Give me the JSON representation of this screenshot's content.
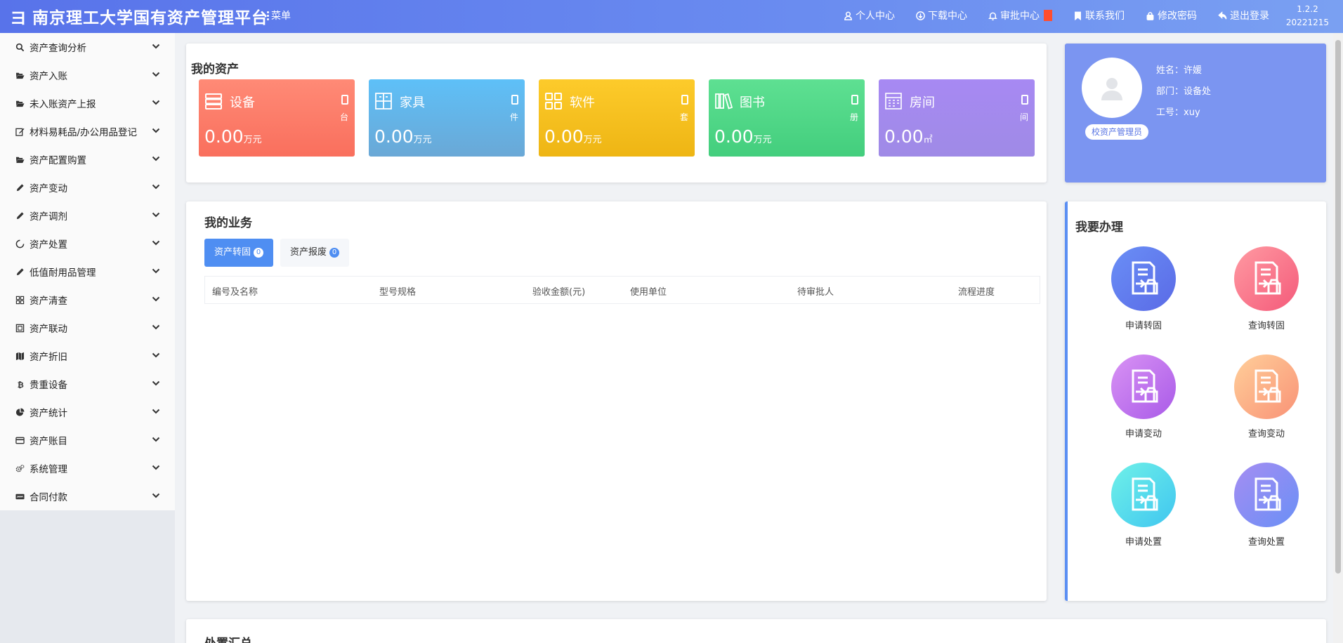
{
  "header": {
    "logo_glyph": "ヨ",
    "title": "南京理工大学国有资产管理平台",
    "menu_label": "菜单",
    "links": [
      {
        "label": "个人中心",
        "icon": "user-icon"
      },
      {
        "label": "下载中心",
        "icon": "download-icon"
      },
      {
        "label": "审批中心",
        "icon": "bell-icon"
      },
      {
        "label": "联系我们",
        "icon": "bookmark-icon"
      },
      {
        "label": "修改密码",
        "icon": "lock-icon"
      },
      {
        "label": "退出登录",
        "icon": "logout-icon"
      }
    ],
    "version": "1.2.2",
    "build": "20221215"
  },
  "sidebar": {
    "items": [
      {
        "label": "资产查询分析",
        "icon": "search-icon"
      },
      {
        "label": "资产入账",
        "icon": "folder-open-icon"
      },
      {
        "label": "未入账资产上报",
        "icon": "folder-open-icon"
      },
      {
        "label": "材料易耗品/办公用品登记",
        "icon": "edit-icon"
      },
      {
        "label": "资产配置购置",
        "icon": "folder-open-icon"
      },
      {
        "label": "资产变动",
        "icon": "pencil-icon"
      },
      {
        "label": "资产调剂",
        "icon": "pencil-icon"
      },
      {
        "label": "资产处置",
        "icon": "circle-notch-icon"
      },
      {
        "label": "低值耐用品管理",
        "icon": "pencil-icon"
      },
      {
        "label": "资产清查",
        "icon": "grid-icon"
      },
      {
        "label": "资产联动",
        "icon": "frame-icon"
      },
      {
        "label": "资产折旧",
        "icon": "map-icon"
      },
      {
        "label": "贵重设备",
        "icon": "bitcoin-icon"
      },
      {
        "label": "资产统计",
        "icon": "pie-chart-icon"
      },
      {
        "label": "资产账目",
        "icon": "credit-card-icon"
      },
      {
        "label": "系统管理",
        "icon": "gears-icon"
      },
      {
        "label": "合同付款",
        "icon": "paypal-icon"
      }
    ]
  },
  "my_assets": {
    "title": "我的资产",
    "cards": [
      {
        "name": "设备",
        "unit": "台",
        "value": "0.00",
        "value_unit": "万元",
        "color_from": "#ff8a76",
        "color_to": "#f96f5d",
        "icon": "server-icon"
      },
      {
        "name": "家具",
        "unit": "件",
        "value": "0.00",
        "value_unit": "万元",
        "color_from": "#5ec0f8",
        "color_to": "#6aa8d6",
        "icon": "furniture-icon"
      },
      {
        "name": "软件",
        "unit": "套",
        "value": "0.00",
        "value_unit": "万元",
        "color_from": "#fdcb2b",
        "color_to": "#eeb514",
        "icon": "apps-icon"
      },
      {
        "name": "图书",
        "unit": "册",
        "value": "0.00",
        "value_unit": "万元",
        "color_from": "#5ee092",
        "color_to": "#43ce7d",
        "icon": "books-icon"
      },
      {
        "name": "房间",
        "unit": "间",
        "value": "0.00",
        "value_unit": "㎡",
        "color_from": "#a789f3",
        "color_to": "#9f8ae6",
        "icon": "building-icon"
      }
    ]
  },
  "profile": {
    "name_label": "姓名：",
    "name": "许媛",
    "dept_label": "部门：",
    "dept": "设备处",
    "id_label": "工号：",
    "id": "xuy",
    "role": "校资产管理员"
  },
  "my_business": {
    "title": "我的业务",
    "tabs": [
      {
        "label": "资产转固",
        "count": "0"
      },
      {
        "label": "资产报废",
        "count": "0"
      }
    ],
    "columns": [
      "编号及名称",
      "型号规格",
      "验收金额(元)",
      "使用单位",
      "待审批人",
      "流程进度"
    ]
  },
  "actions": {
    "title": "我要办理",
    "items": [
      {
        "label": "申请转固",
        "color_from": "#6a8ff6",
        "color_to": "#5a6ae6"
      },
      {
        "label": "查询转固",
        "color_from": "#ff9aa2",
        "color_to": "#f45a7a"
      },
      {
        "label": "申请变动",
        "color_from": "#d993f4",
        "color_to": "#a95ae8"
      },
      {
        "label": "查询变动",
        "color_from": "#ffcf9a",
        "color_to": "#f99276"
      },
      {
        "label": "申请处置",
        "color_from": "#6ff1e8",
        "color_to": "#40c6f0"
      },
      {
        "label": "查询处置",
        "color_from": "#a58ef2",
        "color_to": "#6a8ff6"
      }
    ]
  },
  "summary": {
    "title": "处置汇总"
  }
}
